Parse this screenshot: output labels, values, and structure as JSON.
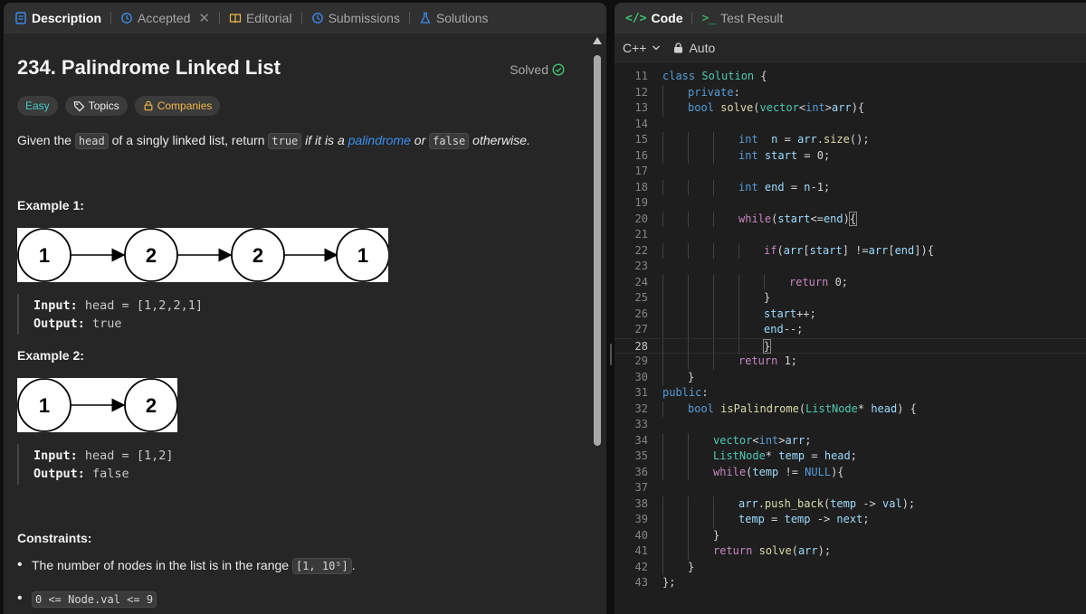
{
  "left_tabs": [
    {
      "label": "Description",
      "icon": "description-icon",
      "active": true
    },
    {
      "label": "Accepted",
      "icon": "history-icon",
      "active": false,
      "closable": true
    },
    {
      "label": "Editorial",
      "icon": "book-icon",
      "active": false
    },
    {
      "label": "Submissions",
      "icon": "history-icon",
      "active": false
    },
    {
      "label": "Solutions",
      "icon": "flask-icon",
      "active": false
    }
  ],
  "problem": {
    "title": "234. Palindrome Linked List",
    "status": "Solved",
    "chips": {
      "difficulty": "Easy",
      "topics": "Topics",
      "companies": "Companies"
    },
    "description": {
      "p1": "Given the ",
      "code_head": "head",
      "p2": " of a singly linked list, return ",
      "code_true": "true",
      "p3": " if it is a ",
      "link": "palindrome",
      "p4": " or ",
      "code_false": "false",
      "p5": " otherwise."
    },
    "examples": [
      {
        "heading": "Example 1:",
        "nodes": [
          "1",
          "2",
          "2",
          "1"
        ],
        "input_label": "Input:",
        "input_value": "head = [1,2,2,1]",
        "output_label": "Output:",
        "output_value": "true"
      },
      {
        "heading": "Example 2:",
        "nodes": [
          "1",
          "2"
        ],
        "input_label": "Input:",
        "input_value": "head = [1,2]",
        "output_label": "Output:",
        "output_value": "false"
      }
    ],
    "constraints_heading": "Constraints:",
    "constraints": [
      {
        "text": "The number of nodes in the list is in the range ",
        "code": "[1, 10⁵]",
        "suffix": "."
      },
      {
        "text": "",
        "code": "0 <= Node.val <= 9",
        "suffix": ""
      }
    ]
  },
  "right_tabs": [
    {
      "label": "Code",
      "icon": "code-icon",
      "active": true
    },
    {
      "label": "Test Result",
      "icon": "terminal-icon",
      "active": false
    }
  ],
  "editor_toolbar": {
    "language": "C++",
    "mode": "Auto"
  },
  "colors": {
    "accent_green": "#3ec46d",
    "easy": "#46c6c2",
    "companies": "#f0b848",
    "link": "#3b8ef0"
  },
  "current_line": 28,
  "code_lines": [
    {
      "n": "11",
      "indent": 0,
      "html": "<span class=\"k\">class</span> <span class=\"t\">Solution</span> {"
    },
    {
      "n": "12",
      "indent": 1,
      "html": "<span class=\"k\">private</span>:"
    },
    {
      "n": "13",
      "indent": 1,
      "html": "<span class=\"k\">bool</span> <span class=\"f\">solve</span>(<span class=\"t\">vector</span>&lt;<span class=\"k\">int</span>&gt;<span class=\"v\">arr</span>){"
    },
    {
      "n": "14",
      "indent": 0,
      "html": ""
    },
    {
      "n": "15",
      "indent": 3,
      "html": "<span class=\"k\">int</span>  <span class=\"v\">n</span> = <span class=\"v\">arr</span>.<span class=\"f\">size</span>();"
    },
    {
      "n": "16",
      "indent": 3,
      "html": "<span class=\"k\">int</span> <span class=\"v\">start</span> = 0;"
    },
    {
      "n": "17",
      "indent": 0,
      "html": ""
    },
    {
      "n": "18",
      "indent": 3,
      "html": "<span class=\"k\">int</span> <span class=\"v\">end</span> = <span class=\"v\">n</span>-1;"
    },
    {
      "n": "19",
      "indent": 0,
      "html": ""
    },
    {
      "n": "20",
      "indent": 3,
      "html": "<span class=\"ctl\">while</span>(<span class=\"v\">start</span>&lt;=<span class=\"v\">end</span>)<span class=\"bracket\">{</span>"
    },
    {
      "n": "21",
      "indent": 0,
      "html": ""
    },
    {
      "n": "22",
      "indent": 4,
      "html": "<span class=\"ctl\">if</span>(<span class=\"v\">arr</span>[<span class=\"v\">start</span>] !=<span class=\"v\">arr</span>[<span class=\"v\">end</span>]){"
    },
    {
      "n": "23",
      "indent": 0,
      "html": ""
    },
    {
      "n": "24",
      "indent": 5,
      "html": "<span class=\"ctl\">return</span> 0;"
    },
    {
      "n": "25",
      "indent": 4,
      "html": "}"
    },
    {
      "n": "26",
      "indent": 4,
      "html": "<span class=\"v\">start</span>++;"
    },
    {
      "n": "27",
      "indent": 4,
      "html": "<span class=\"v\">end</span>--;"
    },
    {
      "n": "28",
      "indent": 4,
      "html": "<span class=\"bracket\">}</span>"
    },
    {
      "n": "29",
      "indent": 3,
      "html": "<span class=\"ctl\">return</span> 1;"
    },
    {
      "n": "30",
      "indent": 1,
      "html": "}"
    },
    {
      "n": "31",
      "indent": 0,
      "html": "<span class=\"k\">public</span>:"
    },
    {
      "n": "32",
      "indent": 1,
      "html": "<span class=\"k\">bool</span> <span class=\"f\">isPalindrome</span>(<span class=\"t\">ListNode</span>* <span class=\"v\">head</span>) {"
    },
    {
      "n": "33",
      "indent": 0,
      "html": ""
    },
    {
      "n": "34",
      "indent": 2,
      "html": "<span class=\"t\">vector</span>&lt;<span class=\"k\">int</span>&gt;<span class=\"v\">arr</span>;"
    },
    {
      "n": "35",
      "indent": 2,
      "html": "<span class=\"t\">ListNode</span>* <span class=\"v\">temp</span> = <span class=\"v\">head</span>;"
    },
    {
      "n": "36",
      "indent": 2,
      "html": "<span class=\"ctl\">while</span>(<span class=\"v\">temp</span> != <span class=\"k\">NULL</span>){"
    },
    {
      "n": "37",
      "indent": 0,
      "html": ""
    },
    {
      "n": "38",
      "indent": 3,
      "html": "<span class=\"v\">arr</span>.<span class=\"f\">push_back</span>(<span class=\"v\">temp</span> -&gt; <span class=\"v\">val</span>);"
    },
    {
      "n": "39",
      "indent": 3,
      "html": "<span class=\"v\">temp</span> = <span class=\"v\">temp</span> -&gt; <span class=\"v\">next</span>;"
    },
    {
      "n": "40",
      "indent": 2,
      "html": "}"
    },
    {
      "n": "41",
      "indent": 2,
      "html": "<span class=\"ctl\">return</span> <span class=\"f\">solve</span>(<span class=\"v\">arr</span>);"
    },
    {
      "n": "42",
      "indent": 1,
      "html": "}"
    },
    {
      "n": "43",
      "indent": 0,
      "html": "};"
    }
  ]
}
